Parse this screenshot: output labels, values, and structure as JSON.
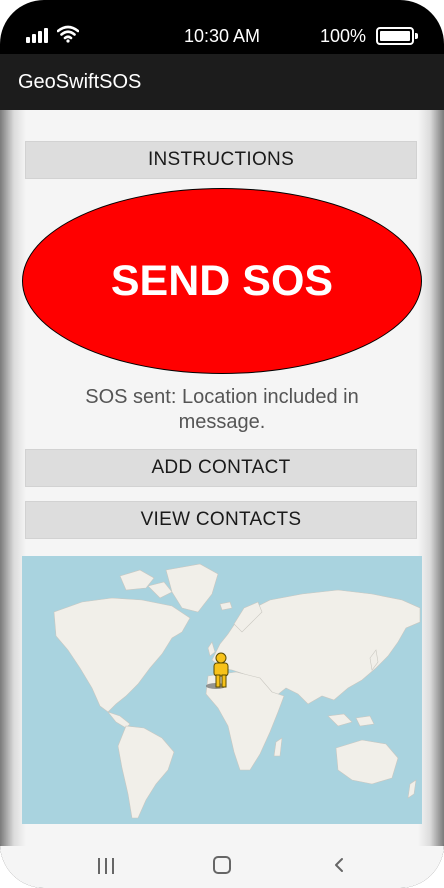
{
  "status_bar": {
    "time": "10:30 AM",
    "battery_percent": "100%",
    "battery_level": 1.0,
    "icons": [
      "signal-icon",
      "wifi-icon",
      "battery-icon"
    ]
  },
  "app_bar": {
    "title": "GeoSwiftSOS"
  },
  "buttons": {
    "instructions": "INSTRUCTIONS",
    "send_sos": "SEND SOS",
    "add_contact": "ADD CONTACT",
    "view_contacts": "VIEW CONTACTS"
  },
  "status_message": "SOS sent: Location included in message.",
  "map": {
    "marker_icon": "pegman-icon"
  },
  "nav_bar": {
    "icons": [
      "recents-icon",
      "home-icon",
      "back-icon"
    ]
  },
  "colors": {
    "sos_red": "#ff0000",
    "button_gray": "#dddddd",
    "water": "#a9d3df",
    "land": "#f1efe9",
    "app_bar": "#1c1c1c"
  }
}
